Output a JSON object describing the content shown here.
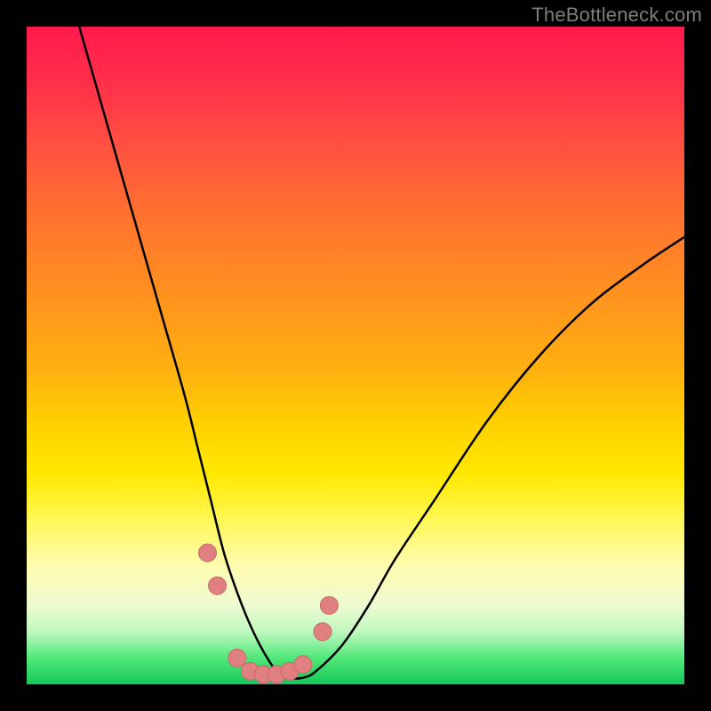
{
  "watermark": "TheBottleneck.com",
  "colors": {
    "background_frame": "#000000",
    "gradient_top": "#ff1a4d",
    "gradient_bottom": "#14c85a",
    "curve_stroke": "#000000",
    "marker_fill": "#e08080",
    "marker_stroke": "#c86a6a"
  },
  "chart_data": {
    "type": "line",
    "title": "",
    "xlabel": "",
    "ylabel": "",
    "xlim": [
      0,
      100
    ],
    "ylim": [
      0,
      100
    ],
    "legend": [],
    "series": [
      {
        "name": "bottleneck-curve",
        "x": [
          8,
          12,
          16,
          20,
          24,
          26,
          28,
          30,
          32,
          34,
          36,
          38,
          40,
          42,
          44,
          48,
          52,
          56,
          62,
          70,
          78,
          86,
          94,
          100
        ],
        "y": [
          100,
          86,
          72,
          58,
          44,
          36,
          28,
          20,
          14,
          9,
          5,
          2,
          1,
          1,
          2,
          6,
          12,
          19,
          28,
          40,
          50,
          58,
          64,
          68
        ]
      }
    ],
    "markers": [
      {
        "x": 27.5,
        "y": 20
      },
      {
        "x": 29.0,
        "y": 15
      },
      {
        "x": 32.0,
        "y": 4
      },
      {
        "x": 34.0,
        "y": 2
      },
      {
        "x": 36.0,
        "y": 1.5
      },
      {
        "x": 38.0,
        "y": 1.5
      },
      {
        "x": 40.0,
        "y": 2
      },
      {
        "x": 42.0,
        "y": 3
      },
      {
        "x": 45.0,
        "y": 8
      },
      {
        "x": 46.0,
        "y": 12
      }
    ]
  }
}
